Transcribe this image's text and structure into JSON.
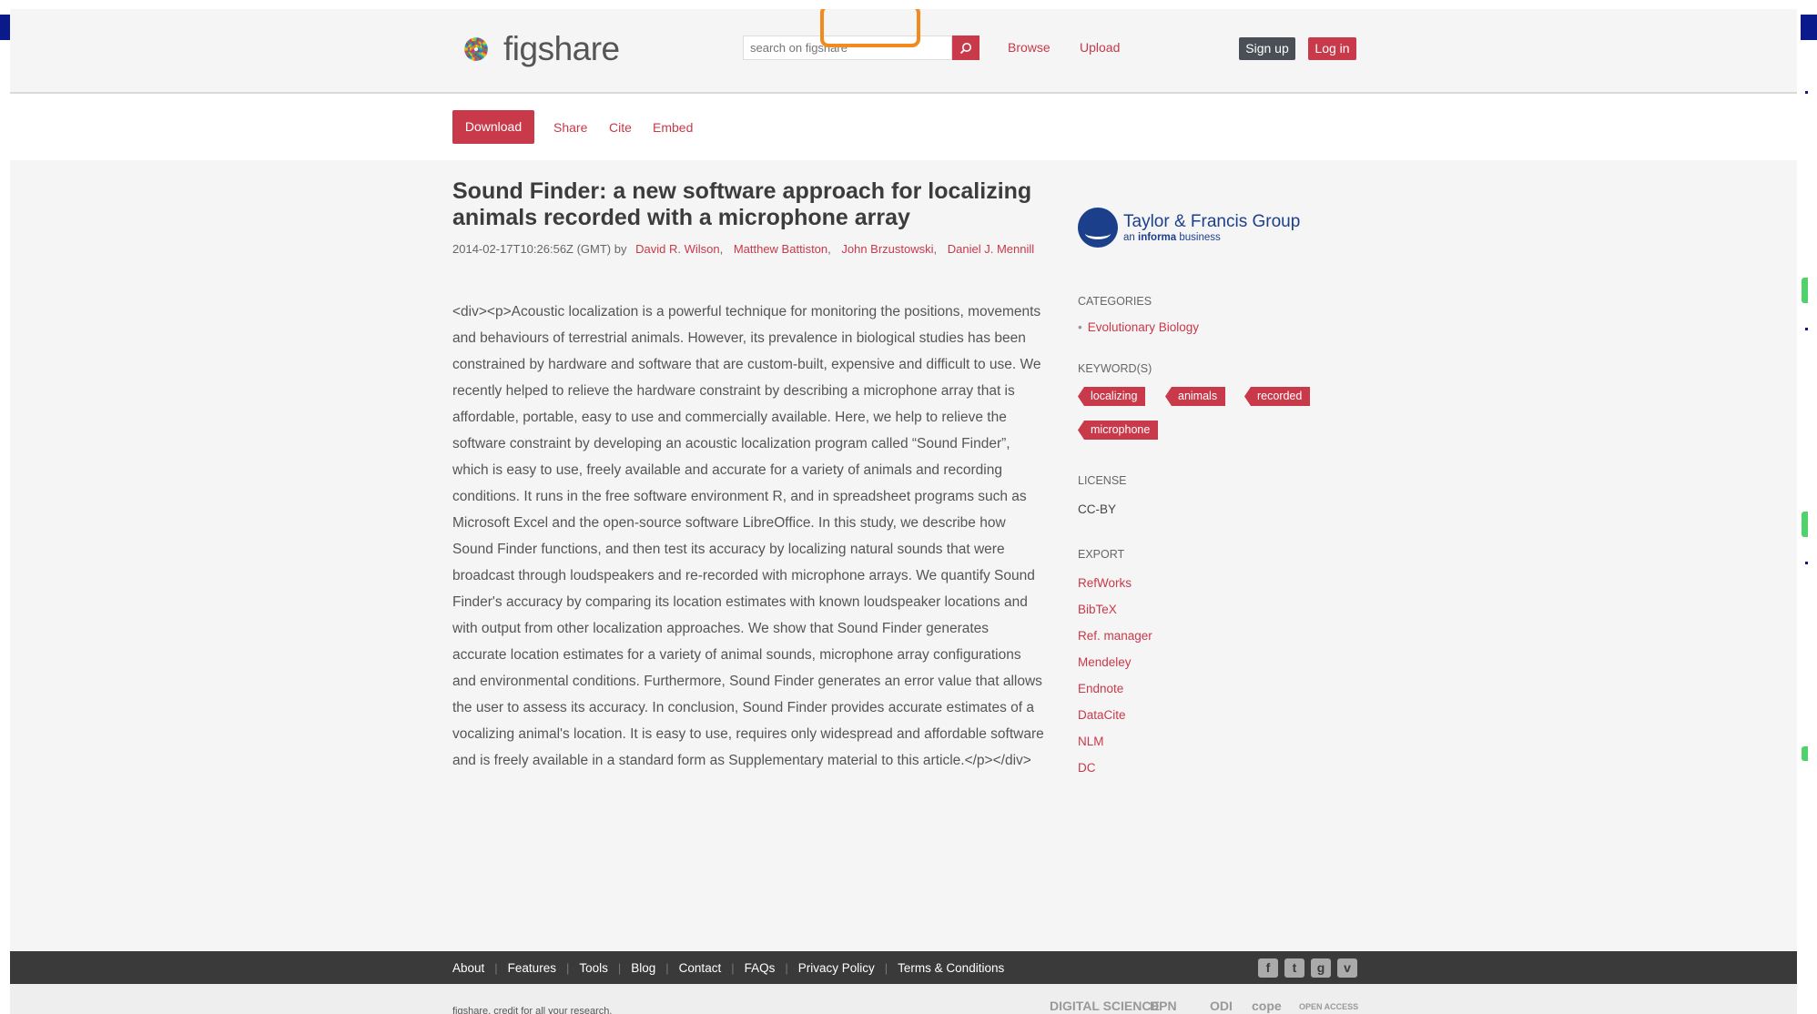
{
  "header": {
    "logo_text": "figshare",
    "search_placeholder": "search on figshare",
    "nav": [
      "Browse",
      "Upload"
    ],
    "signup_label": "Sign up",
    "login_label": "Log in"
  },
  "actions": {
    "download_label": "Download",
    "links": [
      "Share",
      "Cite",
      "Embed"
    ]
  },
  "article": {
    "title": "Sound Finder: a new software approach for localizing animals recorded with a microphone array",
    "date_prefix": "2014-02-17T10:26:56Z (GMT) by",
    "authors": [
      "David R. Wilson",
      "Matthew Battiston",
      "John Brzustowski",
      "Daniel J. Mennill"
    ],
    "abstract": "<div><p>Acoustic localization is a powerful technique for monitoring the positions, movements and behaviours of terrestrial animals. However, its prevalence in biological studies has been constrained by hardware and software that are custom-built, expensive and difficult to use. We recently helped to relieve the hardware constraint by describing a microphone array that is affordable, portable, easy to use and commercially available. Here, we help to relieve the software constraint by developing an acoustic localization program called “Sound Finder”, which is easy to use, freely available and accurate for a variety of animals and recording conditions. It runs in the free software environment R, and in spreadsheet programs such as Microsoft Excel and the open-source software LibreOffice. In this study, we describe how Sound Finder functions, and then test its accuracy by localizing natural sounds that were broadcast through loudspeakers and re-recorded with microphone arrays. We quantify Sound Finder's accuracy by comparing its location estimates with known loudspeaker locations and with output from other localization approaches. We show that Sound Finder generates accurate location estimates for a variety of animal sounds, microphone array configurations and environmental conditions. Furthermore, Sound Finder generates an error value that allows the user to assess its accuracy. In conclusion, Sound Finder provides accurate estimates of a vocalizing animal's location. It is easy to use, requires only widespread and affordable software and is freely available in a standard form as Supplementary material to this article.</p></div>"
  },
  "sidebar": {
    "publisher_name": "Taylor & Francis Group",
    "publisher_sub_prefix": "an ",
    "publisher_sub_bold": "informa",
    "publisher_sub_suffix": " business",
    "categories_heading": "CATEGORIES",
    "categories": [
      "Evolutionary Biology"
    ],
    "keywords_heading": "KEYWORD(S)",
    "keywords": [
      "localizing",
      "animals",
      "recorded",
      "microphone"
    ],
    "license_heading": "LICENSE",
    "license": "CC-BY",
    "export_heading": "EXPORT",
    "export_links": [
      "RefWorks",
      "BibTeX",
      "Ref. manager",
      "Mendeley",
      "Endnote",
      "DataCite",
      "NLM",
      "DC"
    ]
  },
  "footer": {
    "links": [
      "About",
      "Features",
      "Tools",
      "Blog",
      "Contact",
      "FAQs",
      "Privacy Policy",
      "Terms & Conditions"
    ],
    "social": [
      "f",
      "t",
      "g",
      "v"
    ],
    "tagline": "figshare. credit for all your research.",
    "partners": [
      "DIGITAL SCIENCE",
      "DPN",
      "ODI",
      "cope",
      "OPEN ACCESS"
    ]
  },
  "colors": {
    "accent": "#c8394a",
    "dark": "#3a3a3a",
    "publisher": "#1c3f8c",
    "focus": "#f28a1e"
  }
}
